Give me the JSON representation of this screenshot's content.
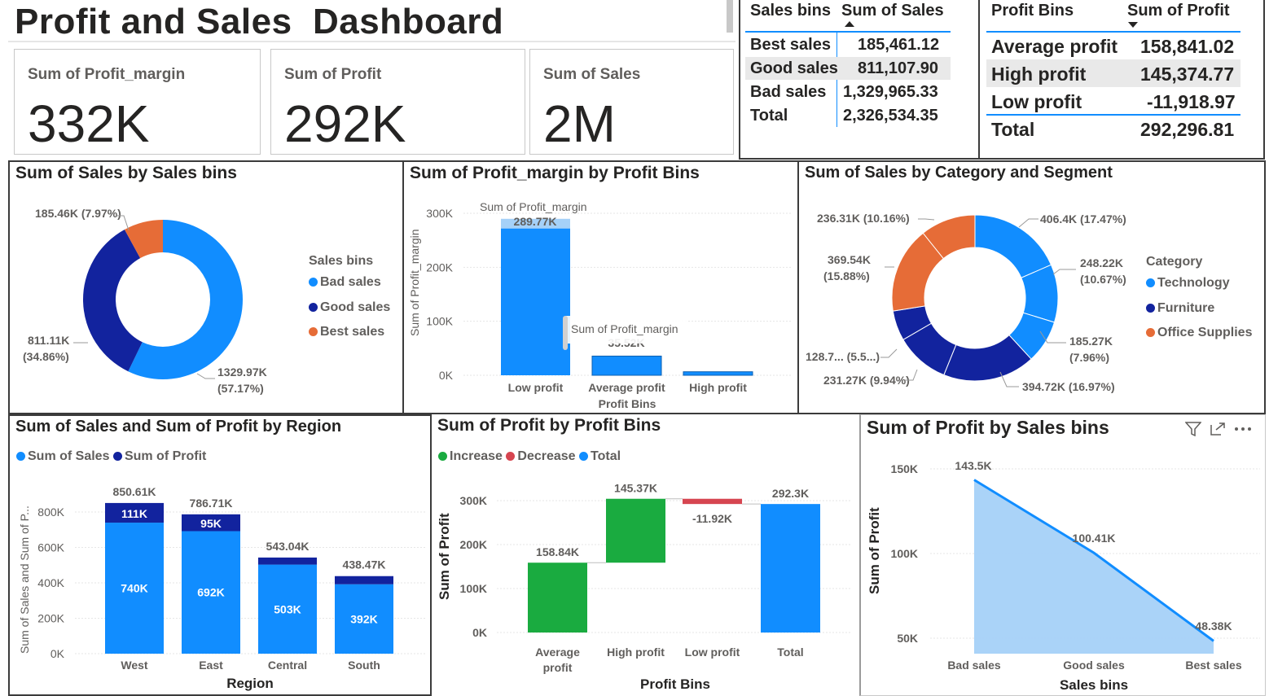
{
  "header": {
    "title": "Profit and Sales  Dashboard"
  },
  "cards": [
    {
      "label": "Sum of Profit_margin",
      "value": "332K"
    },
    {
      "label": "Sum of Profit",
      "value": "292K"
    },
    {
      "label": "Sum of Sales",
      "value": "2M"
    }
  ],
  "sales_table": {
    "headers": [
      "Sales bins",
      "Sum of Sales"
    ],
    "rows": [
      [
        "Best sales",
        "185,461.12"
      ],
      [
        "Good sales",
        "811,107.90"
      ],
      [
        "Bad sales",
        "1,329,965.33"
      ]
    ],
    "total": [
      "Total",
      "2,326,534.35"
    ]
  },
  "profit_table": {
    "headers": [
      "Profit Bins",
      "Sum of Profit"
    ],
    "rows": [
      [
        "Average profit",
        "158,841.02"
      ],
      [
        "High profit",
        "145,374.77"
      ],
      [
        "Low profit",
        "-11,918.97"
      ]
    ],
    "total": [
      "Total",
      "292,296.81"
    ]
  },
  "colors": {
    "blue": "#118DFF",
    "navy": "#12239E",
    "orange": "#E66C37",
    "green": "#1AAB40",
    "red": "#D64550",
    "light": "#a5d1f8"
  },
  "chart_data": [
    {
      "type": "pie",
      "title": "Sum of Sales by Sales bins",
      "legend_title": "Sales bins",
      "categories": [
        "Bad sales",
        "Good sales",
        "Best sales"
      ],
      "values": [
        1329.97,
        811.11,
        185.46
      ],
      "data_labels": [
        "1329.97K",
        "(57.17%)",
        "811.11K",
        "(34.86%)",
        "185.46K (7.97%)"
      ],
      "legend": "right"
    },
    {
      "type": "bar",
      "title": "Sum of Profit_margin by Profit Bins",
      "xlabel": "Profit Bins",
      "ylabel": "Sum of Profit_margin",
      "categories": [
        "Low profit",
        "Average profit",
        "High profit"
      ],
      "values": [
        289.77,
        35.52,
        6.5
      ],
      "data_labels": [
        "289.77K",
        "35.52K"
      ],
      "tooltip_label": "Sum of Profit_margin",
      "y_ticks": [
        "300K",
        "200K",
        "100K",
        "0K"
      ],
      "ylim": [
        0,
        330
      ]
    },
    {
      "type": "pie",
      "title": "Sum of Sales by Category and Segment",
      "legend_title": "Category",
      "categories": [
        "Technology",
        "Furniture",
        "Office Supplies"
      ],
      "values": [
        406.4,
        248.22,
        185.27,
        394.72,
        231.27,
        128.7,
        369.54,
        236.31
      ],
      "data_labels": [
        "406.4K (17.47%)",
        "248.22K",
        "(10.67%)",
        "185.27K",
        "(7.96%)",
        "394.72K (16.97%)",
        "231.27K (9.94%)",
        "128.7... (5.5...)",
        "369.54K",
        "(15.88%)",
        "236.31K (10.16%)"
      ],
      "legend": "right"
    },
    {
      "type": "bar",
      "title": "Sum of Sales and Sum of Profit by Region",
      "xlabel": "Region",
      "ylabel": "Sum of Sales and Sum of P...",
      "legend_items": [
        "Sum of Sales",
        "Sum of Profit"
      ],
      "categories": [
        "West",
        "East",
        "Central",
        "South"
      ],
      "series": [
        {
          "name": "Sum of Sales",
          "values": [
            740,
            692,
            503,
            392
          ],
          "labels": [
            "740K",
            "692K",
            "503K",
            "392K"
          ]
        },
        {
          "name": "Sum of Profit",
          "values": [
            111,
            95,
            40,
            46
          ],
          "labels": [
            "111K",
            "95K",
            "",
            ""
          ]
        }
      ],
      "totals": [
        "850.61K",
        "786.71K",
        "543.04K",
        "438.47K"
      ],
      "y_ticks": [
        "800K",
        "600K",
        "400K",
        "200K",
        "0K"
      ],
      "ylim": [
        0,
        900
      ]
    },
    {
      "type": "bar",
      "title": "Sum of Profit by Profit Bins",
      "xlabel": "Profit Bins",
      "ylabel": "Sum of Profit",
      "legend_items": [
        "Increase",
        "Decrease",
        "Total"
      ],
      "categories": [
        "Average profit",
        "High profit",
        "Low profit",
        "Total"
      ],
      "values": [
        158.84,
        145.37,
        -11.92,
        292.3
      ],
      "data_labels": [
        "158.84K",
        "145.37K",
        "-11.92K",
        "292.3K"
      ],
      "y_ticks": [
        "300K",
        "200K",
        "100K",
        "0K"
      ],
      "ylim": [
        0,
        330
      ]
    },
    {
      "type": "area",
      "title": "Sum of Profit by Sales bins",
      "xlabel": "Sales bins",
      "ylabel": "Sum of Profit",
      "categories": [
        "Bad sales",
        "Good sales",
        "Best sales"
      ],
      "values": [
        143.5,
        100.41,
        48.38
      ],
      "data_labels": [
        "143.5K",
        "100.41K",
        "48.38K"
      ],
      "y_ticks": [
        "150K",
        "100K",
        "50K"
      ],
      "ylim": [
        40,
        160
      ]
    }
  ]
}
